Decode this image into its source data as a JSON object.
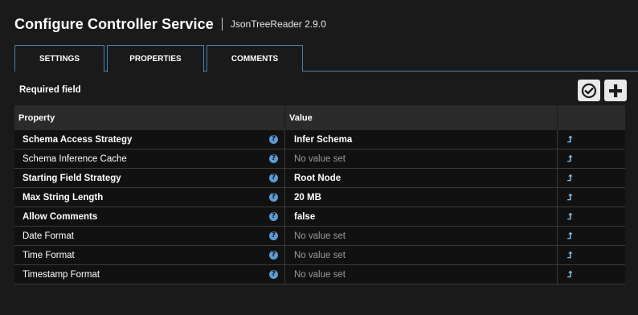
{
  "header": {
    "title": "Configure Controller Service",
    "subtitle": "JsonTreeReader 2.9.0"
  },
  "tabs": [
    {
      "label": "SETTINGS",
      "active": false
    },
    {
      "label": "PROPERTIES",
      "active": true
    },
    {
      "label": "COMMENTS",
      "active": false
    }
  ],
  "required_label": "Required field",
  "toolbar": {
    "verify_icon": "check-circle-icon",
    "add_icon": "plus-icon"
  },
  "table": {
    "headers": [
      "Property",
      "Value",
      ""
    ],
    "rows": [
      {
        "name": "Schema Access Strategy",
        "value": "Infer Schema",
        "required": true,
        "set": true
      },
      {
        "name": "Schema Inference Cache",
        "value": "No value set",
        "required": false,
        "set": false
      },
      {
        "name": "Starting Field Strategy",
        "value": "Root Node",
        "required": true,
        "set": true
      },
      {
        "name": "Max String Length",
        "value": "20 MB",
        "required": true,
        "set": true
      },
      {
        "name": "Allow Comments",
        "value": "false",
        "required": true,
        "set": true
      },
      {
        "name": "Date Format",
        "value": "No value set",
        "required": false,
        "set": false
      },
      {
        "name": "Time Format",
        "value": "No value set",
        "required": false,
        "set": false
      },
      {
        "name": "Timestamp Format",
        "value": "No value set",
        "required": false,
        "set": false
      }
    ]
  },
  "icons": {
    "help": "?",
    "goto": "⮥"
  },
  "colors": {
    "accent": "#4a7fa8",
    "help": "#5b9bd5",
    "background": "#1a1a1a"
  }
}
